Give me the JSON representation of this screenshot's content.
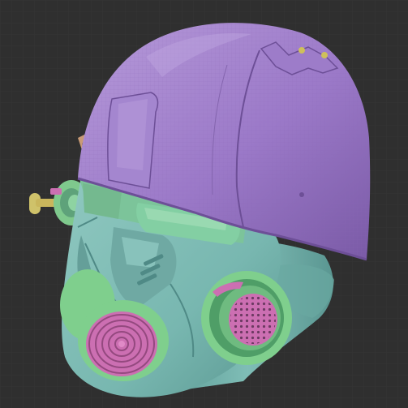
{
  "scene": {
    "subject": "helmet",
    "colors": {
      "background": "#2f2f2f",
      "shell": "#9b79c8",
      "shell_light": "#b69ad9",
      "shell_dark": "#6d4f97",
      "mask": "#78b7b0",
      "mask_light": "#9fd2c9",
      "mask_dark": "#4f8a86",
      "visor": "#7cc49a",
      "visor_light": "#a3ddb7",
      "filter_ring": "#7fcf8d",
      "filter_ring_dark": "#4f9e67",
      "filter_core": "#cc6fb2",
      "filter_core_dark": "#94497f",
      "stud": "#cfc05a",
      "hinge": "#c89a76"
    }
  }
}
